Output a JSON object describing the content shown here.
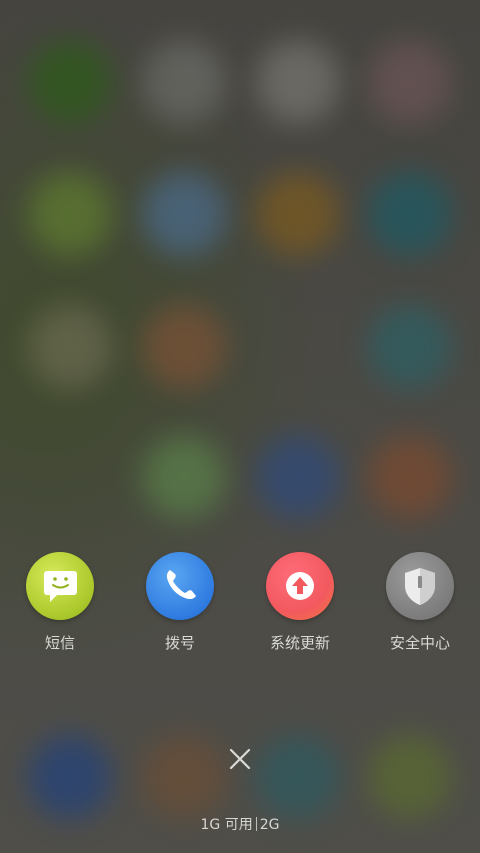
{
  "dock": {
    "apps": [
      {
        "label": "短信",
        "icon": "message-smile-icon",
        "color": "#a9c72a"
      },
      {
        "label": "拨号",
        "icon": "phone-icon",
        "color": "#2f7be0"
      },
      {
        "label": "系统更新",
        "icon": "upload-arrow-icon",
        "color": "#f2595f"
      },
      {
        "label": "安全中心",
        "icon": "shield-icon",
        "color": "#7c7c7c"
      }
    ]
  },
  "close": {
    "icon": "close-icon"
  },
  "memory": {
    "available": "1G 可用",
    "total": "2G"
  }
}
